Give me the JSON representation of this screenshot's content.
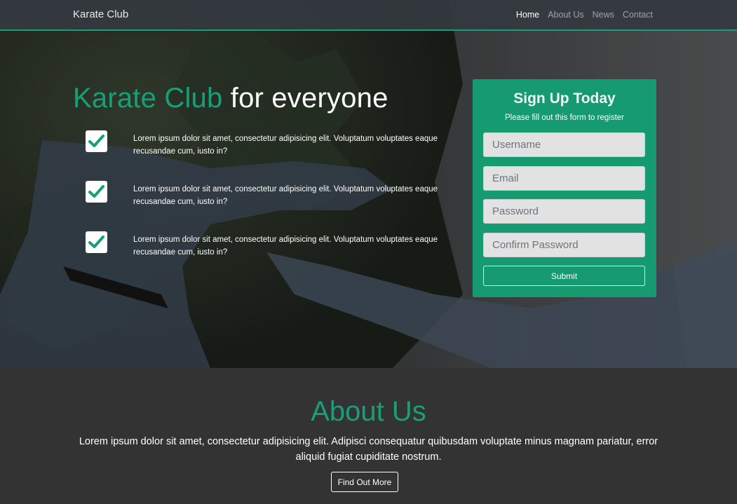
{
  "navbar": {
    "brand": "Karate Club",
    "links": [
      {
        "label": "Home",
        "active": true
      },
      {
        "label": "About Us",
        "active": false
      },
      {
        "label": "News",
        "active": false
      },
      {
        "label": "Contact",
        "active": false
      }
    ]
  },
  "hero": {
    "title_accent": "Karate Club",
    "title_rest": "for everyone",
    "features": [
      {
        "icon": "check-icon",
        "text": "Lorem ipsum dolor sit amet, consectetur adipisicing elit. Voluptatum voluptates eaque recusandae cum, iusto in?"
      },
      {
        "icon": "check-icon",
        "text": "Lorem ipsum dolor sit amet, consectetur adipisicing elit. Voluptatum voluptates eaque recusandae cum, iusto in?"
      },
      {
        "icon": "check-icon",
        "text": "Lorem ipsum dolor sit amet, consectetur adipisicing elit. Voluptatum voluptates eaque recusandae cum, iusto in?"
      }
    ]
  },
  "signup": {
    "title": "Sign Up Today",
    "subtitle": "Please fill out this form to register",
    "username": {
      "placeholder": "Username",
      "value": ""
    },
    "email": {
      "placeholder": "Email",
      "value": ""
    },
    "password": {
      "placeholder": "Password",
      "value": ""
    },
    "confirm_password": {
      "placeholder": "Confirm Password",
      "value": ""
    },
    "submit_label": "Submit"
  },
  "about": {
    "title": "About Us",
    "text": "Lorem ipsum dolor sit amet, consectetur adipisicing elit. Adipisci consequatur quibusdam voluptate minus magnam pariatur, error aliquid fugiat cupiditate nostrum.",
    "button_label": "Find Out More"
  },
  "colors": {
    "accent": "#17a077",
    "signup_bg": "#169a70",
    "navbar_bg": "#343a40",
    "about_bg": "#333333"
  }
}
